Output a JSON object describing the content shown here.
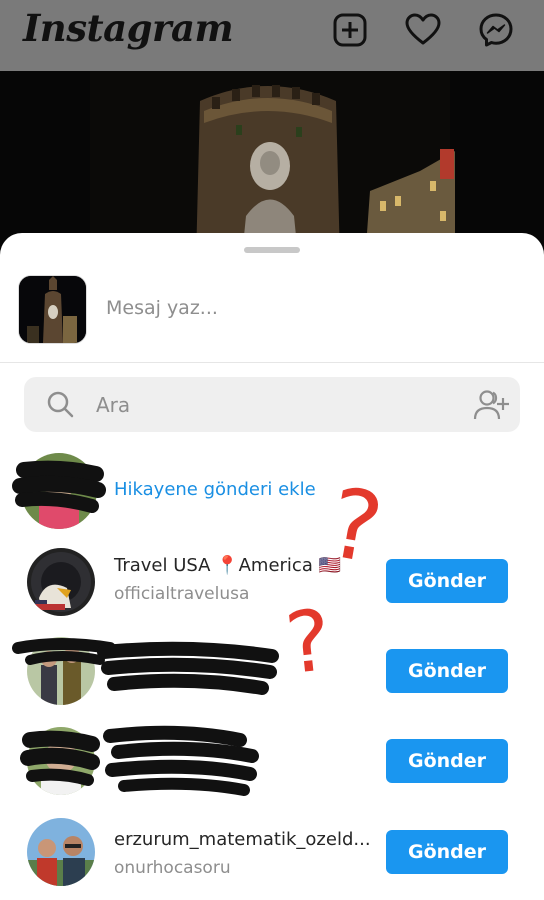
{
  "header": {
    "logo": "Instagram"
  },
  "share_sheet": {
    "message_placeholder": "Mesaj yaz...",
    "search_placeholder": "Ara",
    "add_to_story_label": "Hikayene gönderi ekle",
    "send_label": "Gönder",
    "recipients": [
      {
        "name": "Travel USA 📍America 🇺🇸",
        "username": "officialtravelusa"
      },
      {
        "name": "",
        "username": ""
      },
      {
        "name": "",
        "username": ""
      },
      {
        "name": "erzurum_matematik_ozeld...",
        "username": "onurhocasoru"
      }
    ]
  },
  "annotations": {
    "question_mark": "?"
  },
  "colors": {
    "accent": "#1a96f0",
    "link": "#1a8fe3",
    "annotation": "#e3392c"
  }
}
